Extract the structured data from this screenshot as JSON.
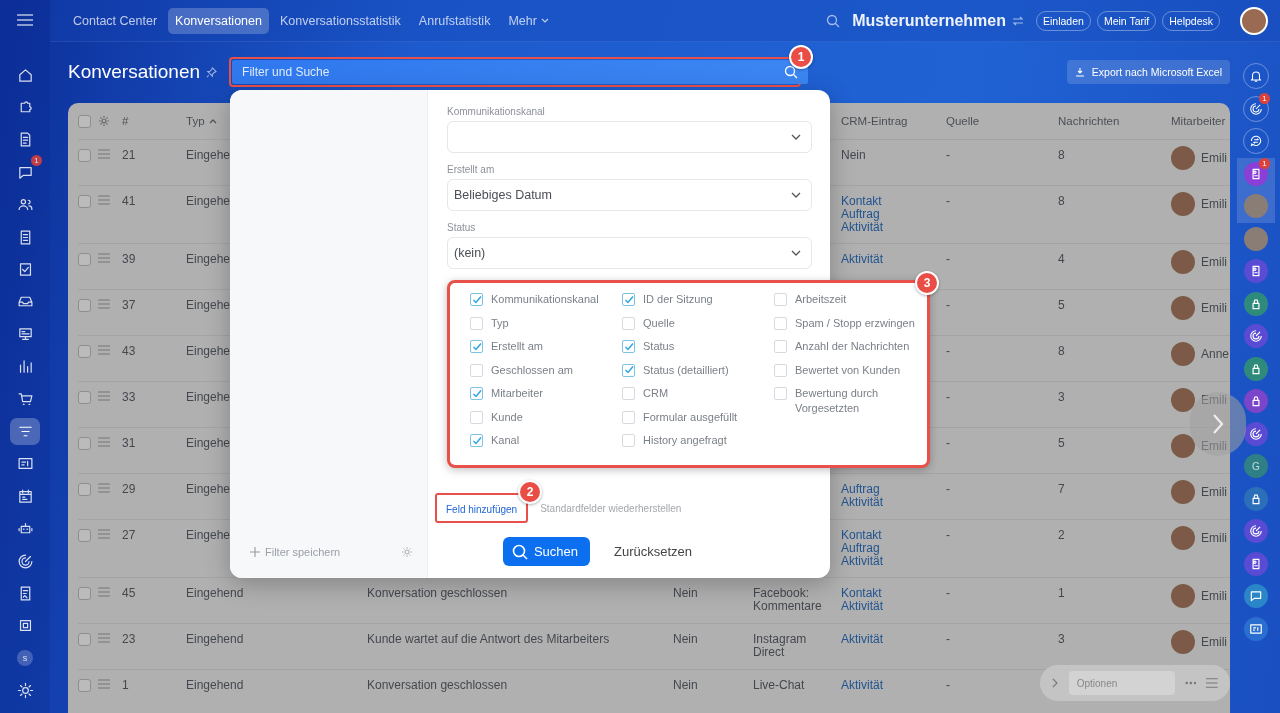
{
  "topbar": {
    "nav": [
      {
        "label": "Contact Center",
        "selected": false,
        "kind": "plain"
      },
      {
        "label": "Konversationen",
        "selected": true,
        "kind": "plain"
      },
      {
        "label": "Konversationsstatistik",
        "selected": false,
        "kind": "plain"
      },
      {
        "label": "Anrufstatistik",
        "selected": false,
        "kind": "plain"
      },
      {
        "label": "Mehr",
        "selected": false,
        "kind": "dropdown"
      }
    ],
    "company": "Musterunternehmen",
    "buttons": [
      "Einladen",
      "Mein Tarif",
      "Helpdesk"
    ]
  },
  "left_sidebar": {
    "items": [
      {
        "kind": "home",
        "selected": false
      },
      {
        "kind": "puzzle",
        "selected": false
      },
      {
        "kind": "doc",
        "selected": false
      },
      {
        "kind": "chat",
        "selected": false,
        "badge": "1"
      },
      {
        "kind": "people",
        "selected": false
      },
      {
        "kind": "file",
        "selected": false
      },
      {
        "kind": "check",
        "selected": false
      },
      {
        "kind": "inbox",
        "selected": false
      },
      {
        "kind": "board",
        "selected": false
      },
      {
        "kind": "chart",
        "selected": false
      },
      {
        "kind": "cart",
        "selected": false
      },
      {
        "kind": "filter",
        "selected": true
      },
      {
        "kind": "card",
        "selected": false
      },
      {
        "kind": "calendar",
        "selected": false
      },
      {
        "kind": "robot",
        "selected": false
      },
      {
        "kind": "target",
        "selected": false
      },
      {
        "kind": "sign",
        "selected": false
      },
      {
        "kind": "box",
        "selected": false
      },
      {
        "kind": "letter",
        "selected": false,
        "letter": "s"
      },
      {
        "kind": "gear",
        "selected": false
      }
    ]
  },
  "right_sidebar": {
    "items": [
      {
        "kind": "bell"
      },
      {
        "kind": "target",
        "badge": "1"
      },
      {
        "kind": "swap"
      },
      {
        "kind": "contact",
        "color": "#8a3fd6",
        "badge": "1",
        "group": true
      },
      {
        "kind": "person",
        "group": true
      },
      {
        "kind": "team"
      },
      {
        "kind": "contact",
        "color": "#5a4bd4"
      },
      {
        "kind": "lock",
        "color": "#2e8b7c"
      },
      {
        "kind": "target",
        "color": "#5a4bd4"
      },
      {
        "kind": "lock",
        "color": "#2e8b7c"
      },
      {
        "kind": "lock",
        "color": "#7b45c9"
      },
      {
        "kind": "target",
        "color": "#5a4bd4"
      },
      {
        "kind": "letter",
        "color": "#2e7f86",
        "letter": "G"
      },
      {
        "kind": "lock",
        "color": "#2b6fb8"
      },
      {
        "kind": "target",
        "color": "#5a4bd4"
      },
      {
        "kind": "contact",
        "color": "#5a4bd4"
      },
      {
        "kind": "chat",
        "color": "#2a86c8"
      },
      {
        "kind": "card",
        "color": "#2a6fd0"
      }
    ]
  },
  "title": "Konversationen",
  "search": {
    "placeholder": "Filter und Suche"
  },
  "export_button": "Export nach Microsoft Excel",
  "table": {
    "headers": {
      "num": "#",
      "type": "Typ",
      "crm": "CRM-Eintrag",
      "source": "Quelle",
      "messages": "Nachrichten",
      "employee": "Mitarbeiter"
    },
    "type_sort_ascending": true,
    "select_all_checked": false,
    "rows": [
      {
        "checked": false,
        "num": "21",
        "type": "Eingehe",
        "crm": [
          {
            "text": "Nein",
            "kind": "plain"
          }
        ],
        "source": "-",
        "messages": "8",
        "employee": "Emili"
      },
      {
        "checked": false,
        "num": "41",
        "type": "Eingehe",
        "crm": [
          {
            "text": "Kontakt",
            "kind": "link"
          },
          {
            "text": "Auftrag",
            "kind": "link"
          },
          {
            "text": "Aktivität",
            "kind": "link"
          }
        ],
        "source": "-",
        "messages": "8",
        "employee": "Emili"
      },
      {
        "checked": false,
        "num": "39",
        "type": "Eingehe",
        "crm": [
          {
            "text": "Aktivität",
            "kind": "link"
          }
        ],
        "source": "-",
        "messages": "4",
        "employee": "Emili"
      },
      {
        "checked": false,
        "num": "37",
        "type": "Eingehe",
        "crm": [],
        "source": "-",
        "messages": "5",
        "employee": "Emili"
      },
      {
        "checked": false,
        "num": "43",
        "type": "Eingehe",
        "crm": [],
        "source": "-",
        "messages": "8",
        "employee": "Anne"
      },
      {
        "checked": false,
        "num": "33",
        "type": "Eingehe",
        "crm": [],
        "source": "-",
        "messages": "3",
        "employee": "Emili"
      },
      {
        "checked": false,
        "num": "31",
        "type": "Eingehe",
        "crm": [],
        "source": "-",
        "messages": "5",
        "employee": "Emili"
      },
      {
        "checked": false,
        "num": "29",
        "type": "Eingehe",
        "crm": [
          {
            "text": "Auftrag",
            "kind": "link"
          },
          {
            "text": "Aktivität",
            "kind": "link"
          }
        ],
        "source": "-",
        "messages": "7",
        "employee": "Emili"
      },
      {
        "checked": false,
        "num": "27",
        "type": "Eingehe",
        "crm": [
          {
            "text": "Kontakt",
            "kind": "link"
          },
          {
            "text": "Auftrag",
            "kind": "link"
          },
          {
            "text": "Aktivität",
            "kind": "link"
          }
        ],
        "source": "-",
        "messages": "2",
        "employee": "Emili"
      },
      {
        "checked": false,
        "num": "45",
        "type": "Eingehend",
        "status": "Konversation geschlossen",
        "closed_flag": "Nein",
        "channel": "Facebook: Kommentare",
        "crm": [
          {
            "text": "Kontakt",
            "kind": "link"
          },
          {
            "text": "Aktivität",
            "kind": "link"
          }
        ],
        "source": "-",
        "messages": "1",
        "employee": "Emili"
      },
      {
        "checked": false,
        "num": "23",
        "type": "Eingehend",
        "status": "Kunde wartet auf die Antwort des Mitarbeiters",
        "closed_flag": "Nein",
        "channel": "Instagram Direct",
        "crm": [
          {
            "text": "Aktivität",
            "kind": "link"
          }
        ],
        "source": "-",
        "messages": "3",
        "employee": "Emili"
      },
      {
        "checked": false,
        "num": "1",
        "type": "Eingehend",
        "status": "Konversation geschlossen",
        "closed_flag": "Nein",
        "channel": "Live-Chat",
        "crm": [
          {
            "text": "Aktivität",
            "kind": "link"
          }
        ],
        "source": "-"
      }
    ]
  },
  "filter_popup": {
    "save_label": "Filter speichern",
    "fields": [
      {
        "label": "Kommunikationskanal"
      },
      {
        "label": "Erstellt am",
        "value": "Beliebiges Datum"
      },
      {
        "label": "Status",
        "value": "(kein)"
      }
    ],
    "add_field_link": "Feld hinzufügen",
    "restore_link": "Standardfelder wiederherstellen",
    "search_button": "Suchen",
    "reset_button": "Zurücksetzen"
  },
  "field_chooser": {
    "columns": [
      [
        {
          "label": "Kommunikationskanal",
          "checked": true
        },
        {
          "label": "Typ",
          "checked": false
        },
        {
          "label": "Erstellt am",
          "checked": true
        },
        {
          "label": "Geschlossen am",
          "checked": false
        },
        {
          "label": "Mitarbeiter",
          "checked": true
        },
        {
          "label": "Kunde",
          "checked": false
        },
        {
          "label": "Kanal",
          "checked": true
        }
      ],
      [
        {
          "label": "ID der Sitzung",
          "checked": true
        },
        {
          "label": "Quelle",
          "checked": false
        },
        {
          "label": "Status",
          "checked": true
        },
        {
          "label": "Status (detailliert)",
          "checked": true
        },
        {
          "label": "CRM",
          "checked": false
        },
        {
          "label": "Formular ausgefüllt",
          "checked": false
        },
        {
          "label": "History angefragt",
          "checked": false
        }
      ],
      [
        {
          "label": "Arbeitszeit",
          "checked": false
        },
        {
          "label": "Spam / Stopp erzwingen",
          "checked": false
        },
        {
          "label": "Anzahl der Nachrichten",
          "checked": false
        },
        {
          "label": "Bewertet von Kunden",
          "checked": false
        },
        {
          "label": "Bewertung durch Vorgesetzten",
          "checked": false
        }
      ]
    ]
  },
  "annotations": [
    "1",
    "2",
    "3"
  ],
  "options_panel": {
    "placeholder": "Optionen"
  }
}
